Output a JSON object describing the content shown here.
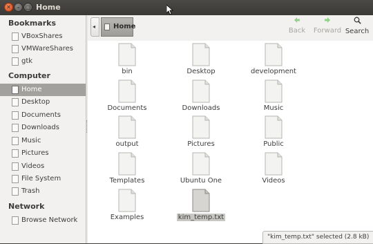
{
  "window": {
    "title": "Home"
  },
  "sidebar": {
    "sections": [
      {
        "heading": "Bookmarks",
        "items": [
          {
            "label": "VBoxShares",
            "icon": "folder-icon",
            "selected": false
          },
          {
            "label": "VMWareShares",
            "icon": "folder-icon",
            "selected": false
          },
          {
            "label": "gtk",
            "icon": "folder-icon",
            "selected": false
          }
        ]
      },
      {
        "heading": "Computer",
        "items": [
          {
            "label": "Home",
            "icon": "home-icon",
            "selected": true
          },
          {
            "label": "Desktop",
            "icon": "desktop-icon",
            "selected": false
          },
          {
            "label": "Documents",
            "icon": "folder-icon",
            "selected": false
          },
          {
            "label": "Downloads",
            "icon": "folder-icon",
            "selected": false
          },
          {
            "label": "Music",
            "icon": "folder-icon",
            "selected": false
          },
          {
            "label": "Pictures",
            "icon": "folder-icon",
            "selected": false
          },
          {
            "label": "Videos",
            "icon": "folder-icon",
            "selected": false
          },
          {
            "label": "File System",
            "icon": "drive-icon",
            "selected": false
          },
          {
            "label": "Trash",
            "icon": "trash-icon",
            "selected": false
          }
        ]
      },
      {
        "heading": "Network",
        "items": [
          {
            "label": "Browse Network",
            "icon": "network-icon",
            "selected": false
          }
        ]
      }
    ]
  },
  "toolbar": {
    "path": {
      "current": "Home",
      "back_glyph": "◂"
    },
    "back": {
      "label": "Back",
      "enabled": false
    },
    "forward": {
      "label": "Forward",
      "enabled": false
    },
    "search": {
      "label": "Search"
    }
  },
  "files": [
    {
      "name": "bin",
      "selected": false
    },
    {
      "name": "Desktop",
      "selected": false
    },
    {
      "name": "development",
      "selected": false
    },
    {
      "name": "Documents",
      "selected": false
    },
    {
      "name": "Downloads",
      "selected": false
    },
    {
      "name": "Music",
      "selected": false
    },
    {
      "name": "output",
      "selected": false
    },
    {
      "name": "Pictures",
      "selected": false
    },
    {
      "name": "Public",
      "selected": false
    },
    {
      "name": "Templates",
      "selected": false
    },
    {
      "name": "Ubuntu One",
      "selected": false
    },
    {
      "name": "Videos",
      "selected": false
    },
    {
      "name": "Examples",
      "selected": false
    },
    {
      "name": "kim_temp.txt",
      "selected": true
    }
  ],
  "status": {
    "text": "\"kim_temp.txt\" selected (2.8 kB)"
  },
  "colors": {
    "selection": "#a3a19d",
    "titlebar": "#3c3b37",
    "sidebar": "#f2f1f0",
    "close": "#e2561f",
    "arrow_disabled": "#8fd18a"
  }
}
